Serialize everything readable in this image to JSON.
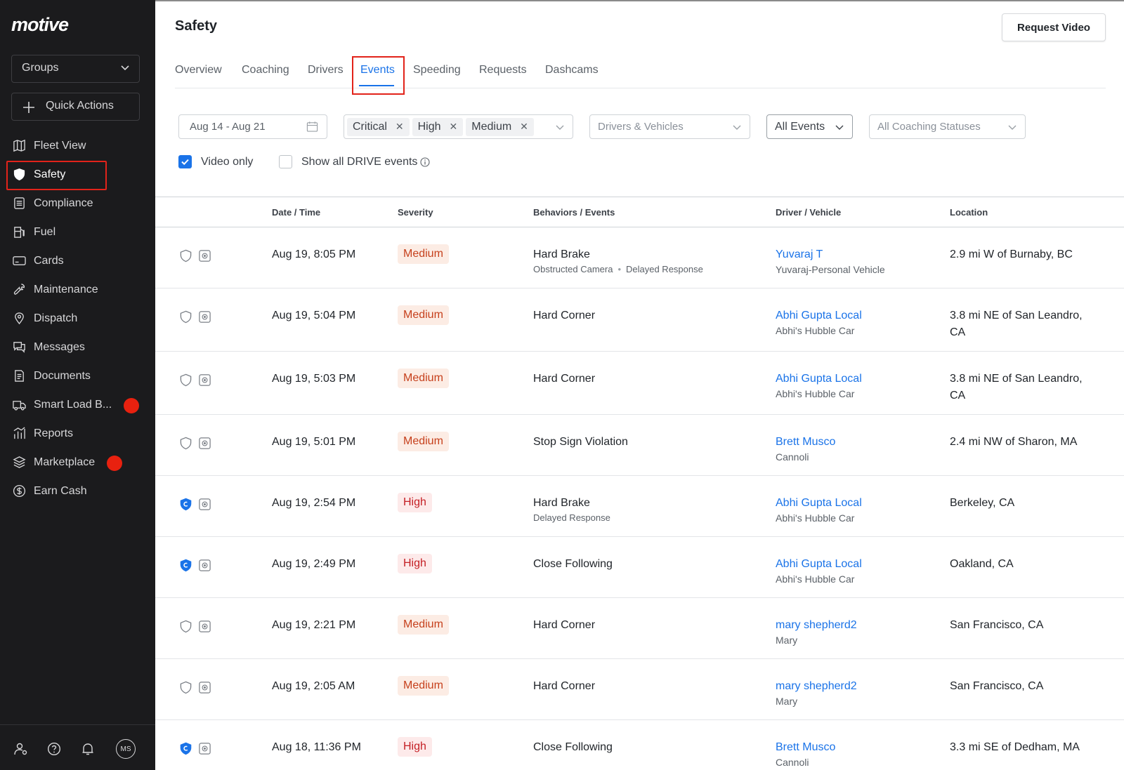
{
  "app": {
    "logo": "motive",
    "groups_label": "Groups",
    "quick_actions_label": "Quick Actions",
    "user_initials": "MS",
    "accent": "#1a73e8"
  },
  "sidebar": {
    "items": [
      {
        "label": "Fleet View",
        "icon": "map-icon"
      },
      {
        "label": "Safety",
        "icon": "shield-icon"
      },
      {
        "label": "Compliance",
        "icon": "list-icon"
      },
      {
        "label": "Fuel",
        "icon": "fuel-pump-icon"
      },
      {
        "label": "Cards",
        "icon": "card-icon"
      },
      {
        "label": "Maintenance",
        "icon": "wrench-icon"
      },
      {
        "label": "Dispatch",
        "icon": "pin-icon"
      },
      {
        "label": "Messages",
        "icon": "chat-icon"
      },
      {
        "label": "Documents",
        "icon": "document-icon"
      },
      {
        "label": "Smart Load B...",
        "icon": "truck-icon"
      },
      {
        "label": "Reports",
        "icon": "chart-icon"
      },
      {
        "label": "Marketplace",
        "icon": "layers-icon"
      },
      {
        "label": "Earn Cash",
        "icon": "dollar-icon"
      }
    ]
  },
  "header": {
    "title": "Safety",
    "request_video": "Request Video"
  },
  "tabs": [
    "Overview",
    "Coaching",
    "Drivers",
    "Events",
    "Speeding",
    "Requests",
    "Dashcams"
  ],
  "filters": {
    "date_range": "Aug 14 - Aug 21",
    "severity_chips": [
      "Critical",
      "High",
      "Medium"
    ],
    "drivers_placeholder": "Drivers & Vehicles",
    "events": "All Events",
    "coaching_placeholder": "All Coaching Statuses",
    "video_only": "Video only",
    "show_drive": "Show all DRIVE events"
  },
  "table": {
    "headers": [
      "Date / Time",
      "Severity",
      "Behaviors / Events",
      "Driver / Vehicle",
      "Location"
    ],
    "rows": [
      {
        "datetime": "Aug 19, 8:05 PM",
        "severity": "Medium",
        "behavior": "Hard Brake",
        "sub1": "Obstructed Camera",
        "sub2": "Delayed Response",
        "driver": "Yuvaraj T",
        "vehicle": "Yuvaraj-Personal Vehicle",
        "location": "2.9 mi W of Burnaby, BC",
        "coached": false
      },
      {
        "datetime": "Aug 19, 5:04 PM",
        "severity": "Medium",
        "behavior": "Hard Corner",
        "sub1": "",
        "sub2": "",
        "driver": "Abhi Gupta Local",
        "vehicle": "Abhi's Hubble Car",
        "location": "3.8 mi NE of San Leandro, CA",
        "coached": false
      },
      {
        "datetime": "Aug 19, 5:03 PM",
        "severity": "Medium",
        "behavior": "Hard Corner",
        "sub1": "",
        "sub2": "",
        "driver": "Abhi Gupta Local",
        "vehicle": "Abhi's Hubble Car",
        "location": "3.8 mi NE of San Leandro, CA",
        "coached": false
      },
      {
        "datetime": "Aug 19, 5:01 PM",
        "severity": "Medium",
        "behavior": "Stop Sign Violation",
        "sub1": "",
        "sub2": "",
        "driver": "Brett Musco",
        "vehicle": "Cannoli",
        "location": "2.4 mi NW of Sharon, MA",
        "coached": false
      },
      {
        "datetime": "Aug 19, 2:54 PM",
        "severity": "High",
        "behavior": "Hard Brake",
        "sub1": "Delayed Response",
        "sub2": "",
        "driver": "Abhi Gupta Local",
        "vehicle": "Abhi's Hubble Car",
        "location": "Berkeley, CA",
        "coached": true
      },
      {
        "datetime": "Aug 19, 2:49 PM",
        "severity": "High",
        "behavior": "Close Following",
        "sub1": "",
        "sub2": "",
        "driver": "Abhi Gupta Local",
        "vehicle": "Abhi's Hubble Car",
        "location": "Oakland, CA",
        "coached": true
      },
      {
        "datetime": "Aug 19, 2:21 PM",
        "severity": "Medium",
        "behavior": "Hard Corner",
        "sub1": "",
        "sub2": "",
        "driver": "mary shepherd2",
        "vehicle": "Mary",
        "location": "San Francisco, CA",
        "coached": false
      },
      {
        "datetime": "Aug 19, 2:05 AM",
        "severity": "Medium",
        "behavior": "Hard Corner",
        "sub1": "",
        "sub2": "",
        "driver": "mary shepherd2",
        "vehicle": "Mary",
        "location": "San Francisco, CA",
        "coached": false
      },
      {
        "datetime": "Aug 18, 11:36 PM",
        "severity": "High",
        "behavior": "Close Following",
        "sub1": "",
        "sub2": "",
        "driver": "Brett Musco",
        "vehicle": "Cannoli",
        "location": "3.3 mi SE of Dedham, MA",
        "coached": true
      }
    ]
  }
}
